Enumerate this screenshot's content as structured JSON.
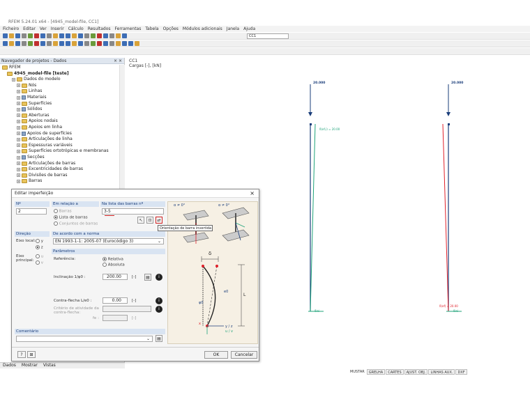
{
  "app": {
    "title": "RFEM 5.24.01 x64 - [4945_model-file, CC1]"
  },
  "menu": [
    "Ficheiro",
    "Editar",
    "Ver",
    "Inserir",
    "Cálculo",
    "Resultados",
    "Ferramentas",
    "Tabela",
    "Opções",
    "Módulos adicionais",
    "Janela",
    "Ajuda"
  ],
  "toolbar": {
    "loadcase": "CC1"
  },
  "navigator": {
    "title": "Navegador de projetos - Dados",
    "close": "× ×",
    "items": [
      {
        "label": "RFEM",
        "level": 0,
        "icon": "rfem"
      },
      {
        "label": "4945_model-file [teste]",
        "level": 1,
        "icon": "folder",
        "bold": true
      },
      {
        "label": "Dados do modelo",
        "level": 2,
        "icon": "folder"
      },
      {
        "label": "Nós",
        "level": 3,
        "icon": "folder"
      },
      {
        "label": "Linhas",
        "level": 3,
        "icon": "folder"
      },
      {
        "label": "Materiais",
        "level": 3,
        "icon": "leaf"
      },
      {
        "label": "Superfícies",
        "level": 3,
        "icon": "folder"
      },
      {
        "label": "Sólidos",
        "level": 3,
        "icon": "leaf"
      },
      {
        "label": "Aberturas",
        "level": 3,
        "icon": "folder"
      },
      {
        "label": "Apoios nodais",
        "level": 3,
        "icon": "folder"
      },
      {
        "label": "Apoios em linha",
        "level": 3,
        "icon": "folder"
      },
      {
        "label": "Apoios de superfícies",
        "level": 3,
        "icon": "leaf"
      },
      {
        "label": "Articulações de linha",
        "level": 3,
        "icon": "folder"
      },
      {
        "label": "Espessuras variáveis",
        "level": 3,
        "icon": "folder"
      },
      {
        "label": "Superfícies ortotrópicas e membranas",
        "level": 3,
        "icon": "folder"
      },
      {
        "label": "Secções",
        "level": 3,
        "icon": "leaf"
      },
      {
        "label": "Articulações de barras",
        "level": 3,
        "icon": "folder"
      },
      {
        "label": "Excentricidades de barras",
        "level": 3,
        "icon": "folder"
      },
      {
        "label": "Divisões de barras",
        "level": 3,
        "icon": "folder"
      },
      {
        "label": "Barras",
        "level": 3,
        "icon": "folder"
      }
    ],
    "tabs": [
      "Dados",
      "Mostrar",
      "Vistas"
    ]
  },
  "canvas": {
    "header1": "CC1",
    "header2": "Cargas [-], [kN]",
    "load_left": "20.000",
    "load_right": "20.000",
    "label_top": "δ(ef,i) = 20.00",
    "label_bottom_left": "δini",
    "label_bottom_right": "δ(ef) = 20.00",
    "label_bottom_right2": "δini"
  },
  "colors": {
    "accent": "#1a3d7a",
    "green": "#1fa37a",
    "red": "#e0202a"
  },
  "dialog": {
    "title": "Editar imperfeição",
    "no_label": "Nº",
    "no_value": "2",
    "relation_label": "Em relação a",
    "relation_options": [
      "Barras",
      "Lista de barras",
      "Conjuntos de barras"
    ],
    "members_label": "Na lista das barras nº",
    "members_value": "3-5",
    "direction_label": "Direção",
    "local_axis_label": "Eixo local:",
    "axis_y": "y",
    "axis_z": "z",
    "principal_axis_label": "Eixo principal:",
    "axis_u": "u",
    "axis_v": "v",
    "norm_label": "De acordo com a norma",
    "norm_value": "EN 1993-1-1: 2005-07 (Eurocódigo 3)",
    "params_label": "Parâmetros",
    "reference_label": "Referência:",
    "ref_relative": "Relativa",
    "ref_absolute": "Absoluta",
    "inclination_label": "Inclinação 1/φ0 :",
    "inclination_value": "200.00",
    "inclination_unit": "[-]",
    "camber_label": "Contra-flecha L/e0 :",
    "camber_value": "0.00",
    "camber_unit": "[-]",
    "camber_criteria": "Critério de atividade da contra-flecha:",
    "fe_label": "fe :",
    "fe_unit": "[-]",
    "comment_label": "Comentário",
    "ok": "OK",
    "cancel": "Cancelar",
    "tooltip": "Orientação de barra invertida",
    "diagram_labels": {
      "a1": "α ≠ 0°",
      "a2": "α ≠ 0°",
      "delta": "δ",
      "e0": "e0",
      "phi": "φ0",
      "L": "L",
      "yz": "y / z",
      "uv": "u / v",
      "x": "x",
      "y": "y",
      "z": "z"
    }
  },
  "statusbar": [
    "MUSTAR",
    "GRELHA",
    "CARTES",
    "AJUST. OBJ.",
    "LINHAS AUX.",
    "DXF"
  ]
}
